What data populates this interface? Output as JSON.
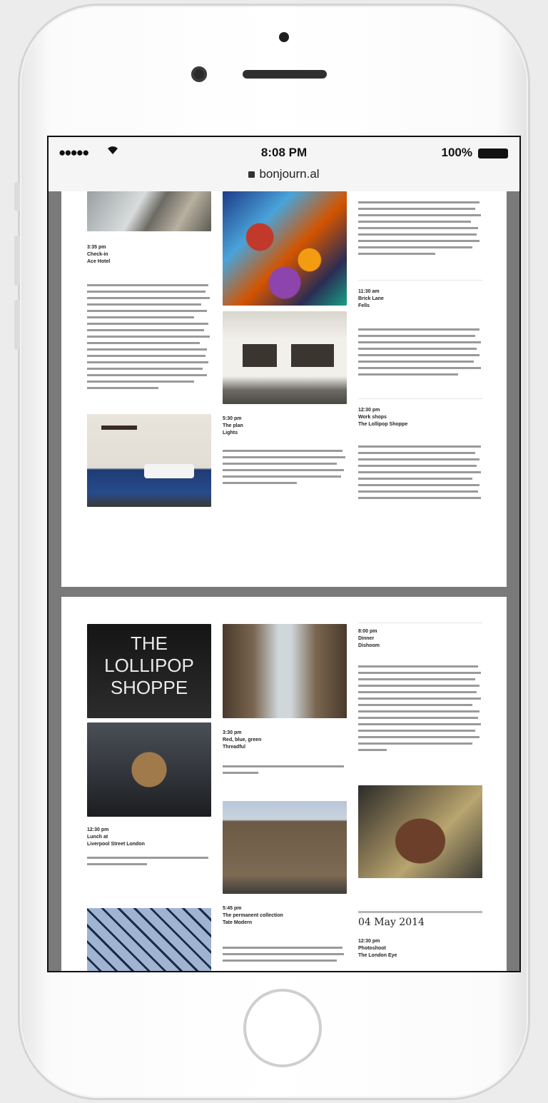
{
  "status_bar": {
    "signal": "●●●●●",
    "time": "8:08 PM",
    "battery": "100%"
  },
  "browser": {
    "url": "bonjourn.al"
  },
  "card_one": {
    "col1": [
      {
        "time": "3:35 pm",
        "title": "Check-in",
        "place": "Ace Hotel"
      },
      {
        "time": "",
        "title": "",
        "place": ""
      }
    ],
    "col2": [
      {
        "time": "5:30 pm",
        "title": "The plan",
        "place": "Lights"
      }
    ],
    "col3": [
      {
        "time": "11:30 am",
        "title": "Brick Lane",
        "place": "Fells"
      },
      {
        "time": "12:30 pm",
        "title": "Work shops",
        "place": "The Lollipop Shoppe"
      }
    ]
  },
  "card_two": {
    "logo_text": [
      "THE",
      "LOLLIPOP",
      "SHOPPE"
    ],
    "col1": [
      {
        "time": "12:30 pm",
        "title": "Lunch at",
        "place": "Liverpool Street London"
      }
    ],
    "col2": [
      {
        "time": "3:30 pm",
        "title": "Red, blue, green",
        "place": "Threadful"
      },
      {
        "time": "5:45 pm",
        "title": "The permanent collection",
        "place": "Tate Modern"
      }
    ],
    "col3": [
      {
        "time": "8:00 pm",
        "title": "Dinner",
        "place": "Dishoom"
      }
    ],
    "day_heading": "04 May 2014",
    "next_entry": {
      "time": "12:30 pm",
      "title": "Photoshoot",
      "place": "The London Eye"
    }
  }
}
